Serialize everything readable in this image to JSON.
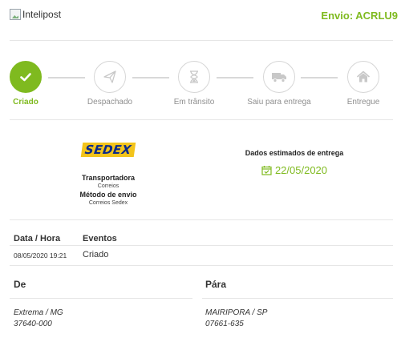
{
  "header": {
    "logo_alt": "Intelipost",
    "shipment": "Envio: ACRLU9"
  },
  "colors": {
    "accent": "#7fba1f",
    "muted": "#8f8f8f",
    "sedex_blue": "#0b2a8a",
    "sedex_yellow": "#f3c41b"
  },
  "steps": [
    {
      "label": "Criado",
      "icon": "check-icon",
      "done": true
    },
    {
      "label": "Despachado",
      "icon": "paper-plane-icon",
      "done": false
    },
    {
      "label": "Em trânsito",
      "icon": "hourglass-icon",
      "done": false
    },
    {
      "label": "Saiu para entrega",
      "icon": "truck-icon",
      "done": false
    },
    {
      "label": "Entregue",
      "icon": "home-icon",
      "done": false
    }
  ],
  "carrier": {
    "logo_text": "SEDEX",
    "carrier_label": "Transportadora",
    "carrier_value": "Correios",
    "method_label": "Método de envio",
    "method_value": "Correios Sedex"
  },
  "estimate": {
    "title": "Dados estimados de entrega",
    "date": "22/05/2020",
    "icon": "calendar-check-icon"
  },
  "events": {
    "date_header": "Data / Hora",
    "event_header": "Eventos",
    "rows": [
      {
        "datetime": "08/05/2020 19:21",
        "event": "Criado"
      }
    ]
  },
  "origin": {
    "label": "De",
    "city": "Extrema / MG",
    "zip": "37640-000"
  },
  "destination": {
    "label": "Pára",
    "city": "MAIRIPORA / SP",
    "zip": "07661-635"
  }
}
